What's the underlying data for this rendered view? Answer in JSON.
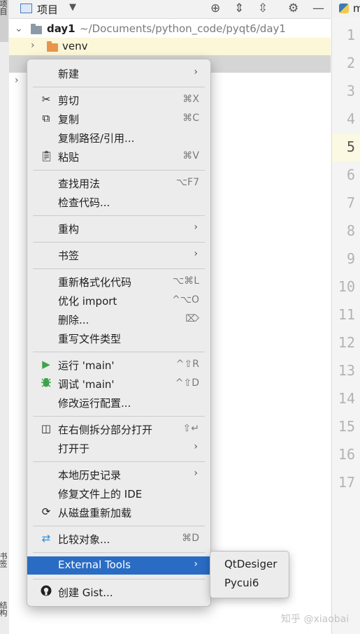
{
  "sidebar": {
    "tab_project": "项目",
    "tab_bookmarks": "书签",
    "tab_structure": "结构"
  },
  "toolbar": {
    "title": "项目"
  },
  "tree": {
    "root": {
      "name": "day1",
      "path": "~/Documents/python_code/pyqt6/day1"
    },
    "venv": {
      "name": "venv"
    }
  },
  "editor": {
    "tab_text": "m",
    "current_line": 5,
    "line_numbers": [
      "1",
      "2",
      "3",
      "4",
      "5",
      "6",
      "7",
      "8",
      "9",
      "10",
      "11",
      "12",
      "13",
      "14",
      "15",
      "16",
      "17"
    ]
  },
  "context_menu": {
    "new": "新建",
    "cut": {
      "label": "剪切",
      "shortcut": "⌘X"
    },
    "copy": {
      "label": "复制",
      "shortcut": "⌘C"
    },
    "copy_path": "复制路径/引用...",
    "paste": {
      "label": "粘贴",
      "shortcut": "⌘V"
    },
    "find_usages": {
      "label": "查找用法",
      "shortcut": "⌥F7"
    },
    "inspect_code": "检查代码...",
    "refactor": "重构",
    "bookmarks": "书签",
    "reformat": {
      "label": "重新格式化代码",
      "shortcut": "⌥⌘L"
    },
    "optimize_imports": {
      "label": "优化 import",
      "shortcut": "^⌥O"
    },
    "delete": {
      "label": "删除...",
      "shortcut": "⌦"
    },
    "override_file_type": "重写文件类型",
    "run": {
      "label": "运行 'main'",
      "shortcut": "^⇧R"
    },
    "debug": {
      "label": "调试 'main'",
      "shortcut": "^⇧D"
    },
    "modify_run_config": "修改运行配置...",
    "split_right": {
      "label": "在右侧拆分部分打开",
      "shortcut": "⇧↵"
    },
    "open_in": "打开于",
    "local_history": "本地历史记录",
    "repair_ide": "修复文件上的 IDE",
    "reload_from_disk": "从磁盘重新加载",
    "compare_with": {
      "label": "比较对象...",
      "shortcut": "⌘D"
    },
    "external_tools": "External Tools",
    "create_gist": "创建 Gist..."
  },
  "submenu": {
    "items": [
      "QtDesiger",
      "Pycui6"
    ]
  },
  "watermark": "知乎 @xiaobai",
  "colors": {
    "highlight": "#2a6cc4",
    "run": "#3fa34d",
    "folder_root": "#8c9aa8",
    "folder_venv": "#e8954b",
    "compare": "#2f8fd8"
  },
  "icons": [
    "scissors-icon",
    "copy-icon",
    "clipboard-icon",
    "play-icon",
    "bug-icon",
    "split-icon",
    "reload-icon",
    "compare-icon",
    "github-icon"
  ]
}
